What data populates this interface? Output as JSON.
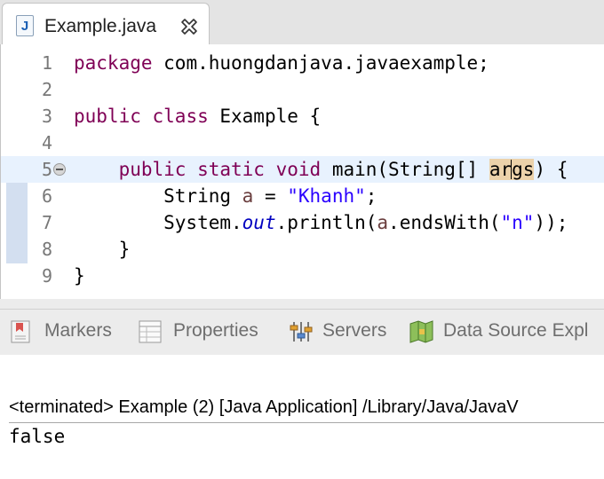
{
  "editor_tab": {
    "title": "Example.java",
    "icon": "java-file-icon",
    "close_icon": "close-icon"
  },
  "editor": {
    "current_line": 5,
    "lines": [
      {
        "num": "1",
        "tokens": [
          {
            "t": "package",
            "c": "kw"
          },
          {
            "t": " com.huongdanjava.javaexample;"
          }
        ]
      },
      {
        "num": "2",
        "tokens": []
      },
      {
        "num": "3",
        "tokens": [
          {
            "t": "public",
            "c": "kw"
          },
          {
            "t": " "
          },
          {
            "t": "class",
            "c": "kw"
          },
          {
            "t": " Example {"
          }
        ]
      },
      {
        "num": "4",
        "tokens": []
      },
      {
        "num": "5",
        "fold": true,
        "tokens": [
          {
            "t": "    "
          },
          {
            "t": "public",
            "c": "kw"
          },
          {
            "t": " "
          },
          {
            "t": "static",
            "c": "kw"
          },
          {
            "t": " "
          },
          {
            "t": "void",
            "c": "kw"
          },
          {
            "t": " main(String[] "
          },
          {
            "t": "ar",
            "c": "hl"
          },
          {
            "caret": true
          },
          {
            "t": "gs",
            "c": "hl"
          },
          {
            "t": ") {"
          }
        ]
      },
      {
        "num": "6",
        "tokens": [
          {
            "t": "        String "
          },
          {
            "t": "a",
            "c": "local"
          },
          {
            "t": " = "
          },
          {
            "t": "\"Khanh\"",
            "c": "str"
          },
          {
            "t": ";"
          }
        ]
      },
      {
        "num": "7",
        "tokens": [
          {
            "t": "        System."
          },
          {
            "t": "out",
            "c": "fld"
          },
          {
            "t": ".println("
          },
          {
            "t": "a",
            "c": "local"
          },
          {
            "t": ".endsWith("
          },
          {
            "t": "\"n\"",
            "c": "str"
          },
          {
            "t": "));"
          }
        ]
      },
      {
        "num": "8",
        "tokens": [
          {
            "t": "    }"
          }
        ]
      },
      {
        "num": "9",
        "tokens": [
          {
            "t": "}"
          }
        ]
      }
    ]
  },
  "views": {
    "tabs": [
      {
        "label": "Markers",
        "icon": "markers-icon"
      },
      {
        "label": "Properties",
        "icon": "properties-icon"
      },
      {
        "label": "Servers",
        "icon": "servers-icon"
      },
      {
        "label": "Data Source Expl",
        "icon": "data-source-icon"
      }
    ]
  },
  "console": {
    "header": "<terminated> Example (2) [Java Application] /Library/Java/JavaV",
    "output": "false"
  },
  "colors": {
    "keyword": "#7f0055",
    "string": "#2a00ff",
    "field": "#0000c0",
    "current_line": "#e8f2fe"
  }
}
